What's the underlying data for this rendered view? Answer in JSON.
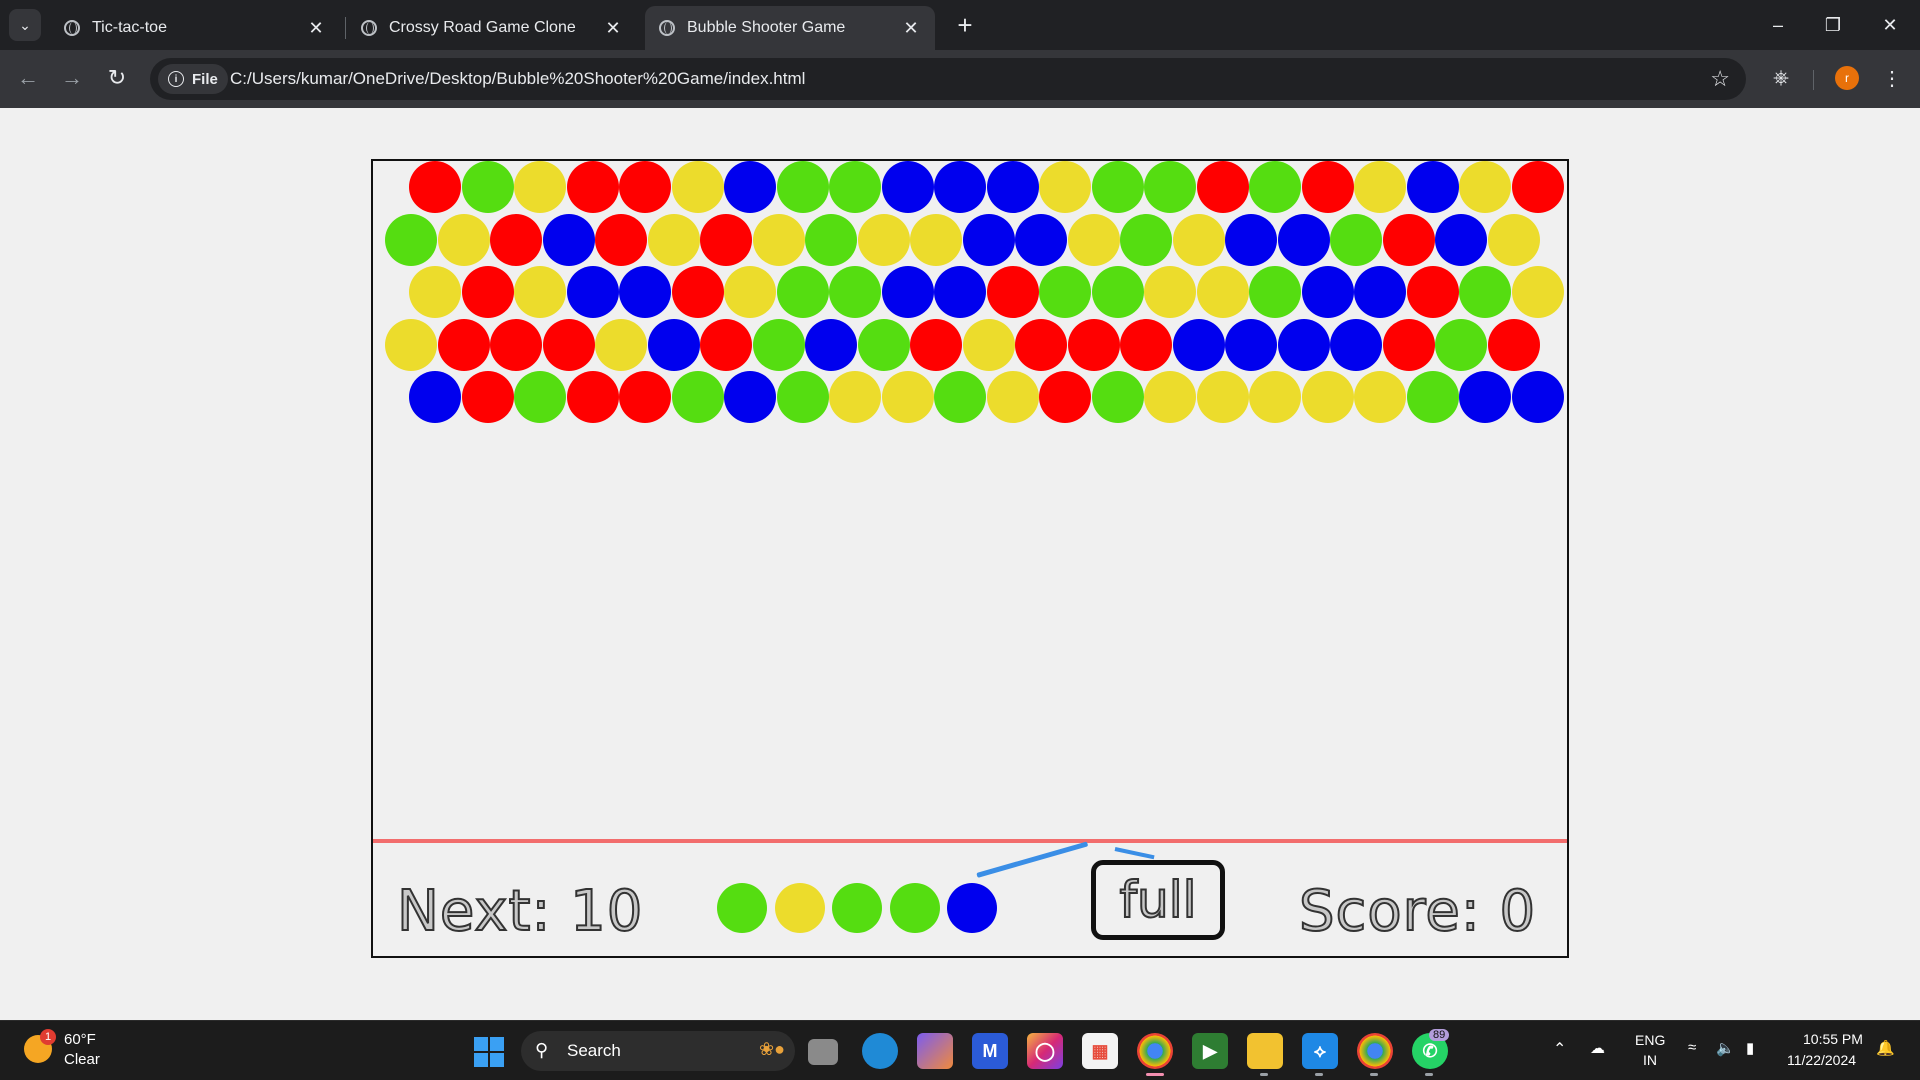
{
  "browser": {
    "tabs": [
      {
        "title": "Tic-tac-toe",
        "active": false
      },
      {
        "title": "Crossy Road Game Clone",
        "active": false
      },
      {
        "title": "Bubble Shooter Game",
        "active": true
      }
    ],
    "chip_label": "File",
    "url": "C:/Users/kumar/OneDrive/Desktop/Bubble%20Shooter%20Game/index.html",
    "profile_initial": "r"
  },
  "game": {
    "colors": {
      "R": "#ff0000",
      "G": "#55dd11",
      "Y": "#ecdc2c",
      "B": "#0000ee"
    },
    "rows": [
      "RGYRRYBGGBBBYGGRGRYBYR",
      "GYRBRYRYGYYBBYGYBBGRBY",
      "YRYBBRYGGBBRGGYYGBBRGY",
      "YRRRYBRGBGRYRRRBBBBRGR",
      "BRGRRGBGYYGYRGYYYYYGBB"
    ],
    "next_label": "Next: 10",
    "next_queue": [
      "G",
      "Y",
      "G",
      "G",
      "B"
    ],
    "full_button": "full",
    "score_label": "Score: 0"
  },
  "taskbar": {
    "weather_badge": "1",
    "temperature": "60°F",
    "condition": "Clear",
    "search_label": "Search",
    "whatsapp_badge": "89",
    "lang_top": "ENG",
    "lang_bottom": "IN",
    "time": "10:55 PM",
    "date": "11/22/2024"
  }
}
